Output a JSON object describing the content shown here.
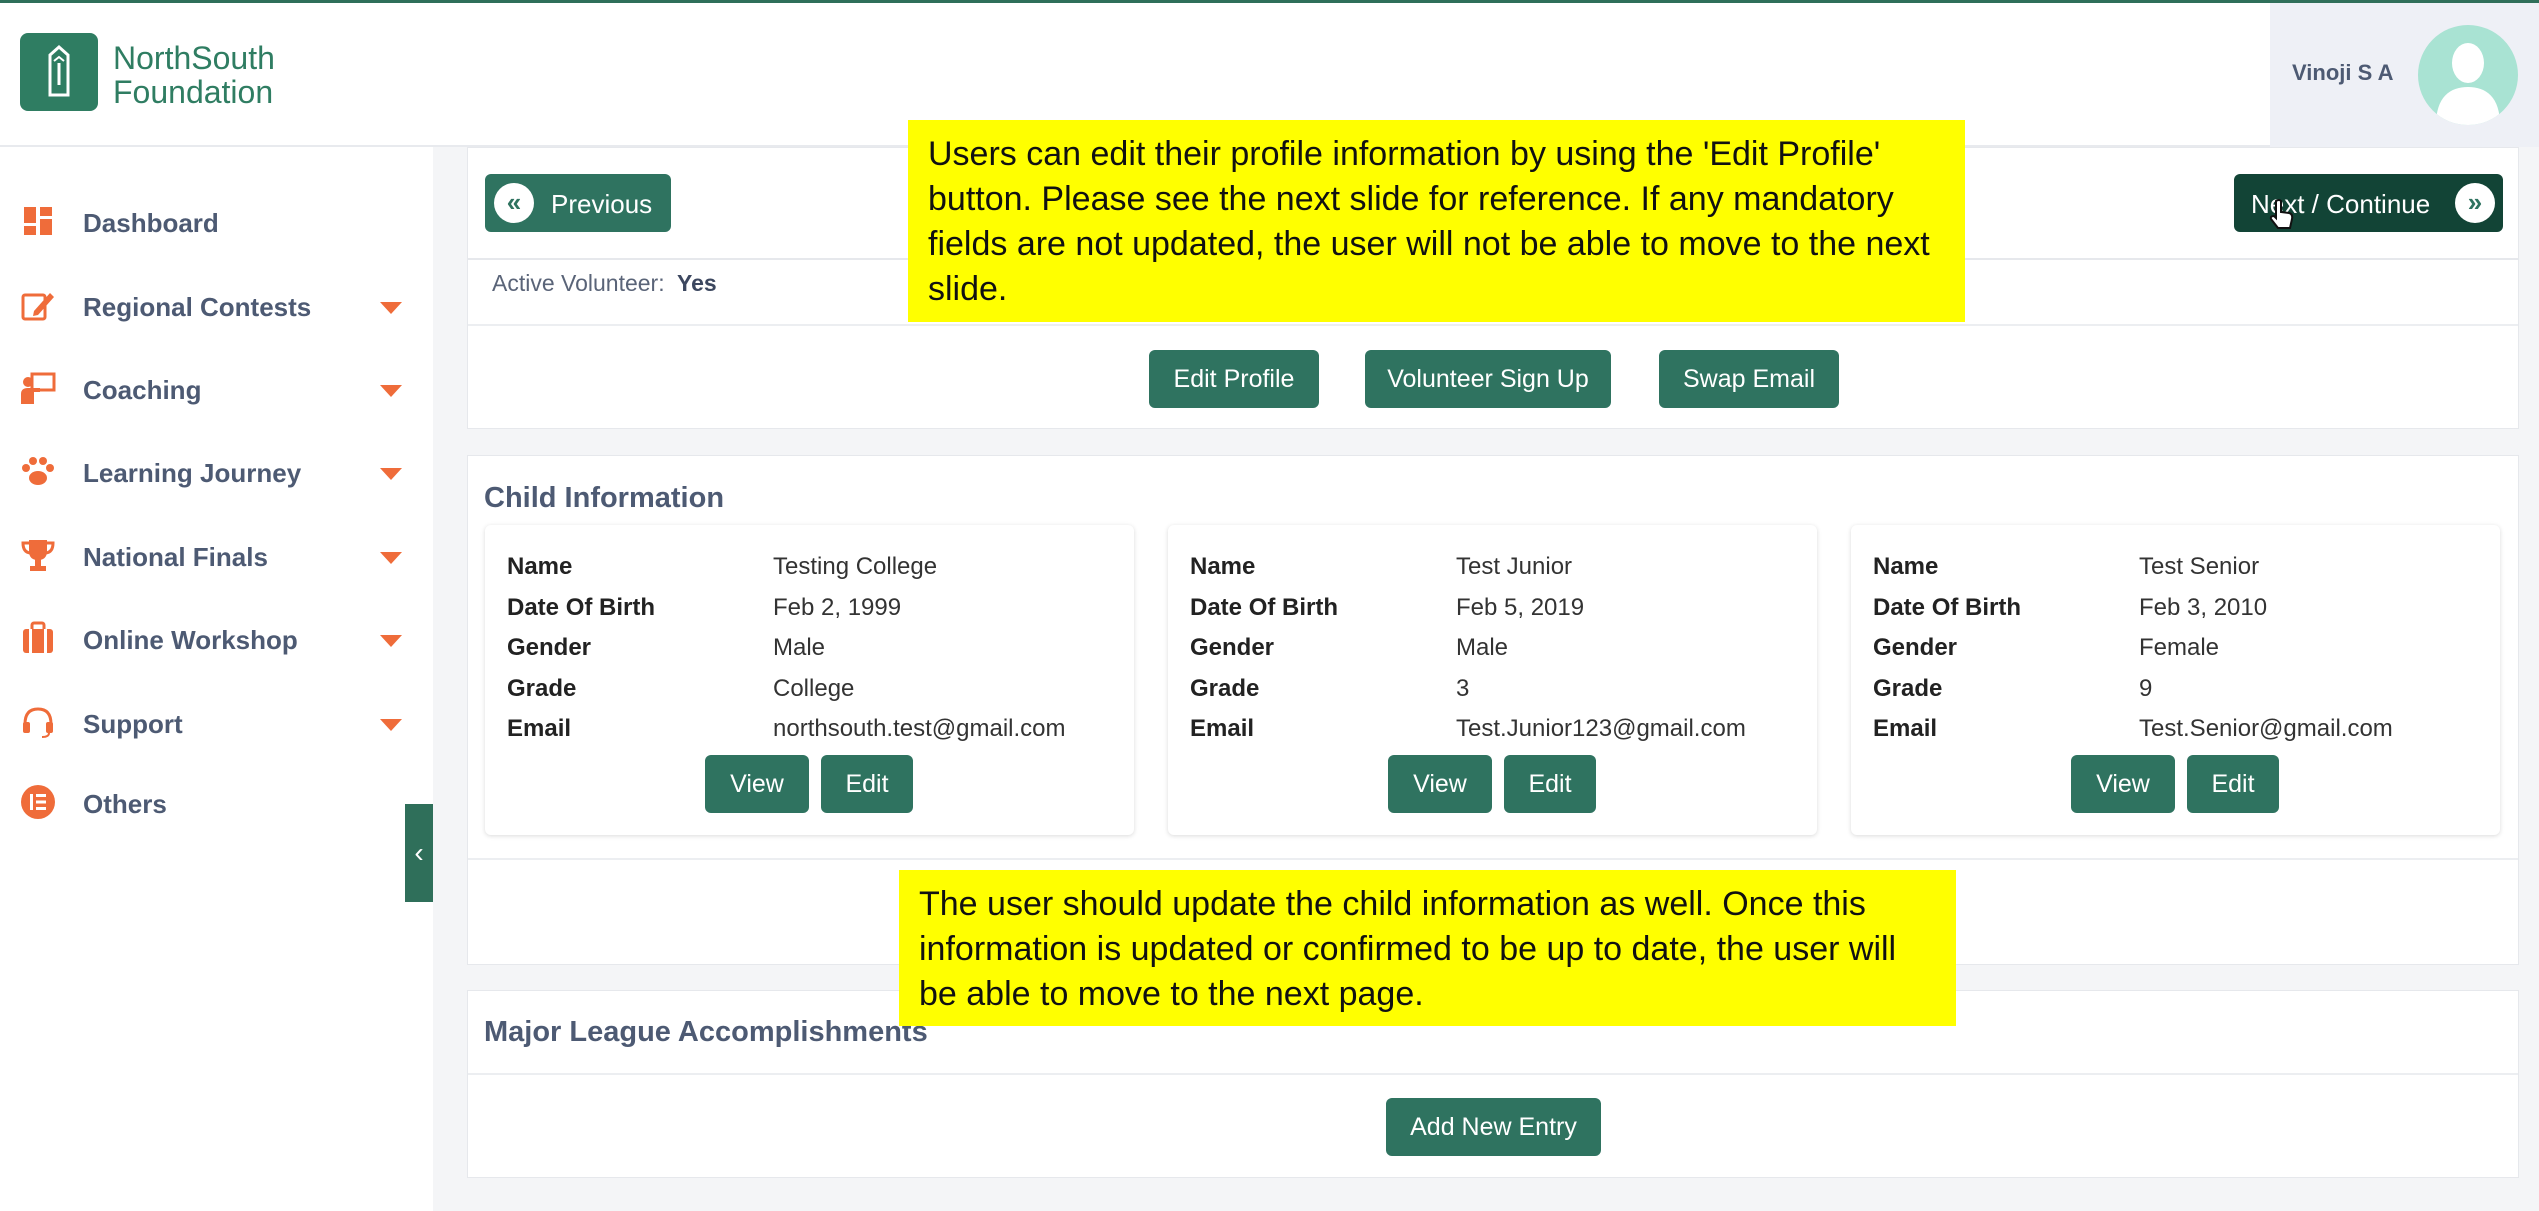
{
  "brand": {
    "line1": "NorthSouth",
    "line2": "Foundation"
  },
  "user": {
    "name": "Vinoji S A"
  },
  "colors": {
    "accent": "#2f7360",
    "caret": "#ef6c3a",
    "callout": "#ffff00"
  },
  "sidebar": {
    "items": [
      {
        "label": "Dashboard",
        "icon": "dashboard-icon",
        "has_caret": false
      },
      {
        "label": "Regional Contests",
        "icon": "pencil-note-icon",
        "has_caret": true
      },
      {
        "label": "Coaching",
        "icon": "presenter-icon",
        "has_caret": true
      },
      {
        "label": "Learning Journey",
        "icon": "paw-icon",
        "has_caret": true
      },
      {
        "label": "National Finals",
        "icon": "trophy-icon",
        "has_caret": true
      },
      {
        "label": "Online Workshop",
        "icon": "briefcase-icon",
        "has_caret": true
      },
      {
        "label": "Support",
        "icon": "headset-icon",
        "has_caret": true
      },
      {
        "label": "Others",
        "icon": "list-icon",
        "has_caret": false
      }
    ]
  },
  "nav": {
    "previous": "Previous",
    "next": "Next / Continue"
  },
  "profile": {
    "active_label": "Active Volunteer:",
    "active_value": "Yes",
    "buttons": {
      "edit": "Edit Profile",
      "volunteer": "Volunteer Sign Up",
      "swap": "Swap Email"
    }
  },
  "callouts": {
    "top": "Users can edit their profile information by using the 'Edit Profile' button. Please see the next slide for reference. If any mandatory fields are not updated, the user will not be able to move to the next slide.",
    "bottom": "The user should update the child information as well. Once this information is updated or confirmed to be up to date, the user will be able to move to the next page."
  },
  "child_section": {
    "title": "Child Information",
    "labels": {
      "name": "Name",
      "dob": "Date Of Birth",
      "gender": "Gender",
      "grade": "Grade",
      "email": "Email"
    },
    "view_label": "View",
    "edit_label": "Edit",
    "children": [
      {
        "name": "Testing College",
        "dob": "Feb 2, 1999",
        "gender": "Male",
        "grade": "College",
        "email": "northsouth.test@gmail.com"
      },
      {
        "name": "Test Junior",
        "dob": "Feb 5, 2019",
        "gender": "Male",
        "grade": "3",
        "email": "Test.Junior123@gmail.com"
      },
      {
        "name": "Test Senior",
        "dob": "Feb 3, 2010",
        "gender": "Female",
        "grade": "9",
        "email": "Test.Senior@gmail.com"
      }
    ]
  },
  "major_league": {
    "title": "Major League Accomplishments",
    "add_label": "Add New Entry"
  }
}
